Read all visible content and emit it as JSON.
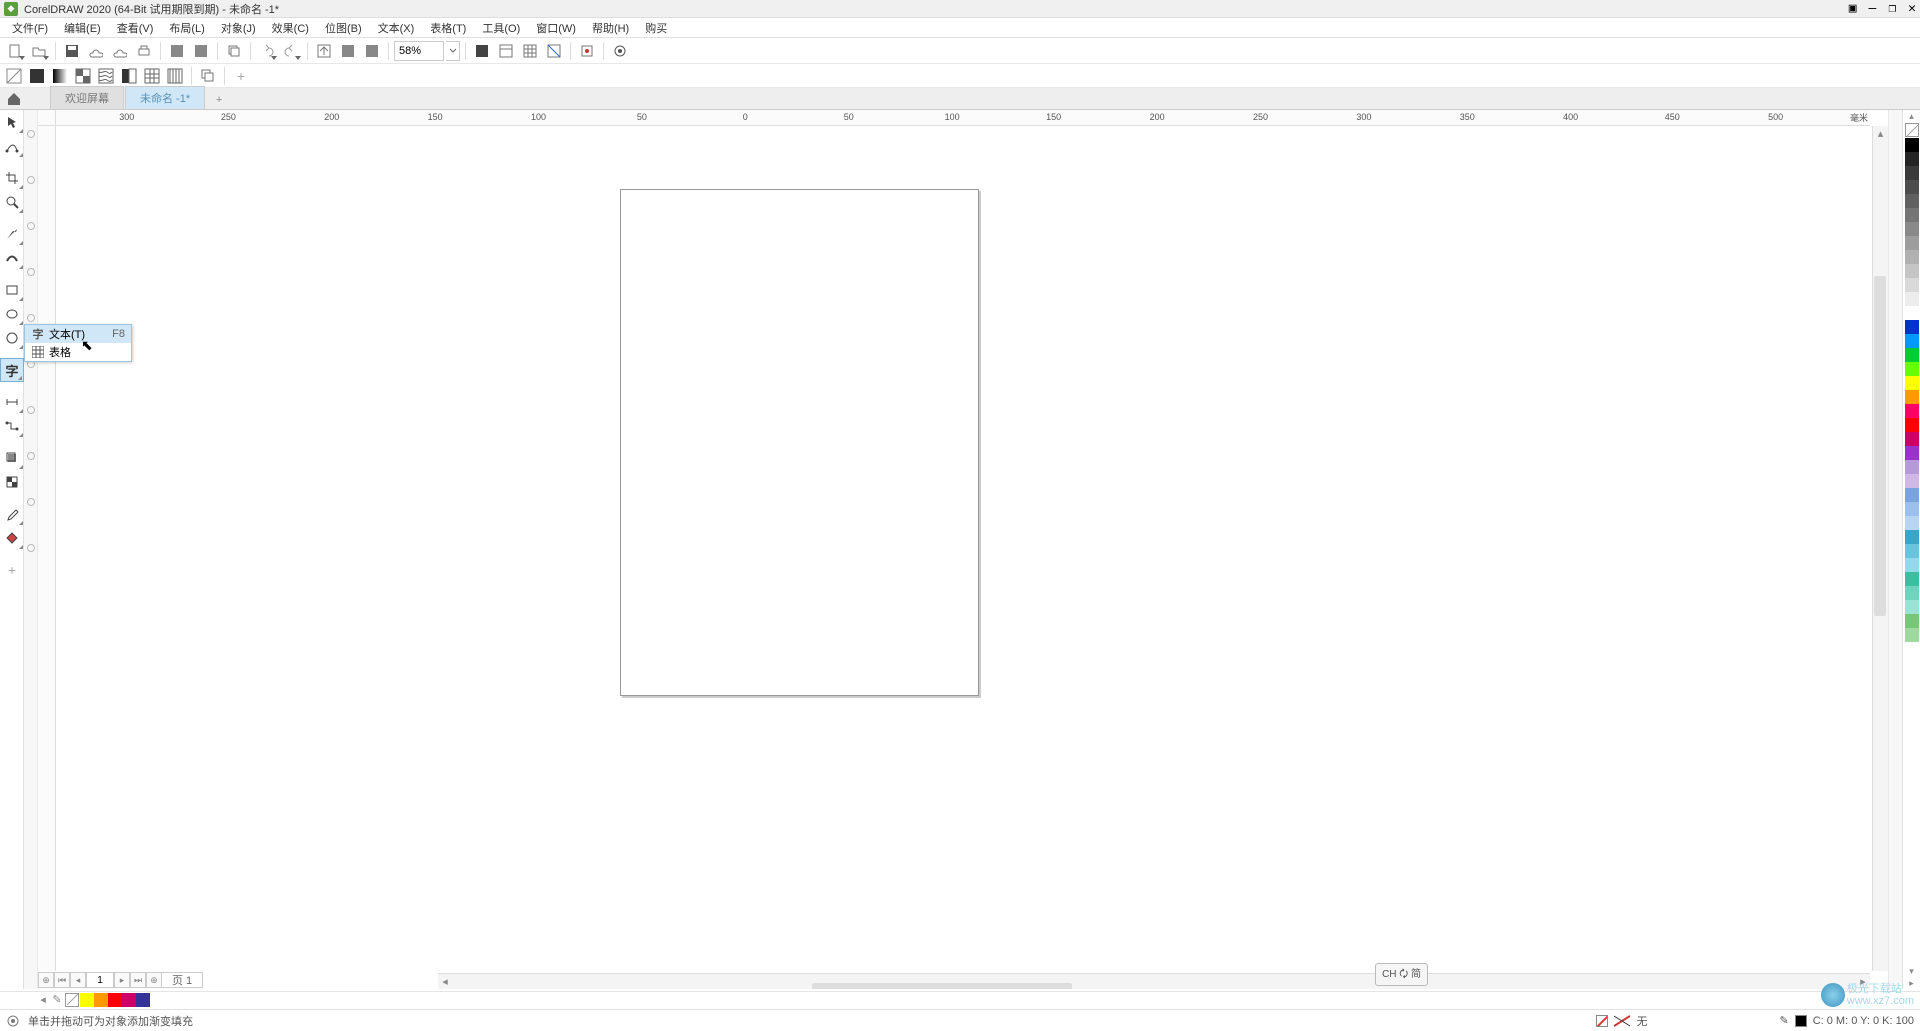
{
  "title": "CorelDRAW 2020 (64-Bit 试用期限到期) - 未命名 -1*",
  "menu": [
    "文件(F)",
    "编辑(E)",
    "查看(V)",
    "布局(L)",
    "对象(J)",
    "效果(C)",
    "位图(B)",
    "文本(X)",
    "表格(T)",
    "工具(O)",
    "窗口(W)",
    "帮助(H)",
    "购买"
  ],
  "zoom": "58%",
  "tabs": {
    "welcome": "欢迎屏幕",
    "doc": "未命名 -1*"
  },
  "ruler_unit": "毫米",
  "ruler_marks": [
    {
      "x": 3.9,
      "label": "300"
    },
    {
      "x": 9.5,
      "label": "250"
    },
    {
      "x": 15.2,
      "label": "200"
    },
    {
      "x": 20.9,
      "label": "150"
    },
    {
      "x": 26.6,
      "label": "100"
    },
    {
      "x": 32.3,
      "label": "50"
    },
    {
      "x": 38.0,
      "label": "0"
    },
    {
      "x": 43.7,
      "label": "50"
    },
    {
      "x": 49.4,
      "label": "100"
    },
    {
      "x": 55.0,
      "label": "150"
    },
    {
      "x": 60.7,
      "label": "200"
    },
    {
      "x": 66.4,
      "label": "250"
    },
    {
      "x": 72.1,
      "label": "300"
    },
    {
      "x": 77.8,
      "label": "350"
    },
    {
      "x": 83.5,
      "label": "400"
    },
    {
      "x": 89.1,
      "label": "450"
    },
    {
      "x": 94.8,
      "label": "500"
    }
  ],
  "flyout": {
    "text_label": "文本(T)",
    "text_shortcut": "F8",
    "table_label": "表格"
  },
  "page_nav": {
    "current": "1",
    "page_label": "页 1"
  },
  "ime": "CH 🗘 简",
  "status": {
    "hint": "单击并拖动可为对象添加渐变填充",
    "fill_label": "无",
    "coords": "C:  0 M:  0 Y:  0 K: 100"
  },
  "palette_colors": [
    "#000000",
    "#242424",
    "#3a3a3a",
    "#4d4d4d",
    "#616161",
    "#757575",
    "#898989",
    "#9d9d9d",
    "#b1b1b1",
    "#c5c5c5",
    "#d9d9d9",
    "#ededed",
    "#ffffff",
    "#0033cc",
    "#0099ff",
    "#00cc33",
    "#66ff00",
    "#ffff00",
    "#ff9900",
    "#ff0066",
    "#ff0000",
    "#cc0066",
    "#9933cc",
    "#b599d9",
    "#cfb8e6",
    "#7aa3e0",
    "#9dbfeb",
    "#b8d4f2",
    "#3aa6c9",
    "#6bc4de",
    "#94d8eb",
    "#3bbfa0",
    "#6fd4bd",
    "#9be3d4",
    "#78c778",
    "#a0d9a0"
  ],
  "bottom_palette": [
    "#ffff00",
    "#ff9900",
    "#ff0000",
    "#cc0066",
    "#333399"
  ],
  "watermark": "极光下载站\nwww.xz7.com"
}
